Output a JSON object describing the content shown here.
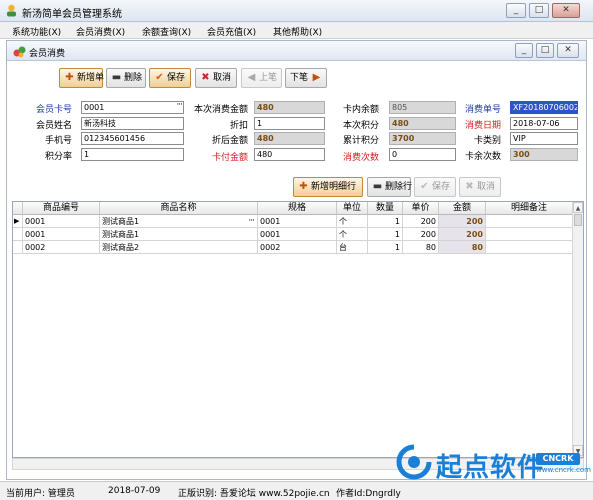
{
  "app": {
    "title": "新汤简单会员管理系统",
    "icon": "app-icon"
  },
  "window_controls": {
    "minimize": "_",
    "maximize": "□",
    "close": "✕"
  },
  "menu": [
    {
      "label": "系统功能(X)"
    },
    {
      "label": "会员消费(X)"
    },
    {
      "label": "余额查询(X)"
    },
    {
      "label": "会员充值(X)"
    },
    {
      "label": "其他帮助(X)"
    }
  ],
  "child": {
    "title": "会员消费"
  },
  "toolbar": {
    "new": "新增单",
    "delete": "删除",
    "save": "保存",
    "cancel": "取消",
    "prev": "上笔",
    "next": "下笔"
  },
  "form": {
    "card_no": {
      "label": "会员卡号",
      "value": "0001"
    },
    "name": {
      "label": "会员姓名",
      "value": "新汤科技"
    },
    "phone": {
      "label": "手机号",
      "value": "012345601456"
    },
    "rate": {
      "label": "积分率",
      "value": "1"
    },
    "consume_amount": {
      "label": "本次消费金额",
      "value": "480"
    },
    "discount": {
      "label": "折扣",
      "value": "1"
    },
    "after_discount": {
      "label": "折后金额",
      "value": "480"
    },
    "card_pay": {
      "label": "卡付金额",
      "value": "480"
    },
    "balance": {
      "label": "卡内余额",
      "value": "805"
    },
    "points": {
      "label": "本次积分",
      "value": "480"
    },
    "total_points": {
      "label": "累计积分",
      "value": "3700"
    },
    "times": {
      "label": "消费次数",
      "value": "0"
    },
    "order_no": {
      "label": "消费单号",
      "value": "XF20180706002"
    },
    "order_date": {
      "label": "消费日期",
      "value": "2018-07-06"
    },
    "card_type": {
      "label": "卡类别",
      "value": "VIP"
    },
    "remaining_times": {
      "label": "卡余次数",
      "value": "300"
    }
  },
  "detail_toolbar": {
    "add": "新增明细行",
    "delete": "删除行",
    "save": "保存",
    "cancel": "取消"
  },
  "grid": {
    "columns": [
      "商品编号",
      "商品名称",
      "规格",
      "单位",
      "数量",
      "单价",
      "金额",
      "明细备注"
    ],
    "rows": [
      [
        "0001",
        "测试商品1",
        "0001",
        "个",
        "1",
        "200",
        "200",
        ""
      ],
      [
        "0001",
        "测试商品1",
        "0001",
        "个",
        "1",
        "200",
        "200",
        ""
      ],
      [
        "0002",
        "测试商品2",
        "0002",
        "台",
        "1",
        "80",
        "80",
        ""
      ]
    ]
  },
  "status": {
    "user": "当前用户: 管理员",
    "date": "2018-07-09",
    "license": "正版识别: 吾爱论坛 www.52pojie.cn",
    "author": "作者Id:Dngrdly"
  },
  "watermark": {
    "text": "起点软件",
    "badge": "CNCRK",
    "url": "www.cncrk.com"
  }
}
